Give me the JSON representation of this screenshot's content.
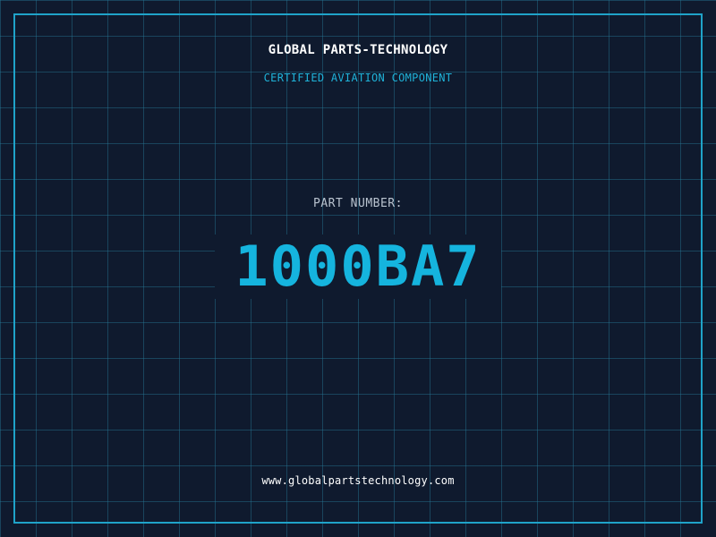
{
  "brand": {
    "name": "GLOBAL PARTS-TECHNOLOGY",
    "tagline": "CERTIFIED AVIATION COMPONENT"
  },
  "part": {
    "label": "PART NUMBER:",
    "number": "1000BA7"
  },
  "footer": {
    "url": "www.globalpartstechnology.com"
  },
  "colors": {
    "background": "#0f1a2e",
    "grid": "#26789a",
    "accent": "#1fa3c9",
    "part_number": "#15b4de",
    "text_primary": "#ffffff",
    "text_muted": "#b9c3cf"
  }
}
